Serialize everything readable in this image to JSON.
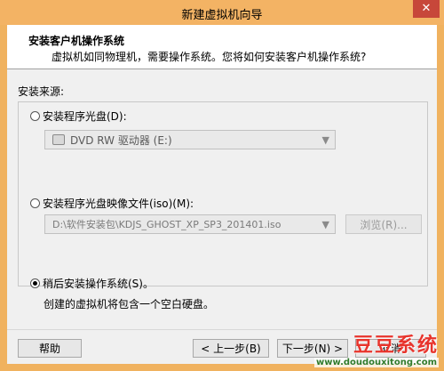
{
  "window": {
    "title": "新建虚拟机向导",
    "close_glyph": "✕"
  },
  "header": {
    "title": "安装客户机操作系统",
    "subtitle": "虚拟机如同物理机，需要操作系统。您将如何安装客户机操作系统?"
  },
  "install_source_label": "安装来源:",
  "options": {
    "disc": {
      "label": "安装程序光盘(D):",
      "selected": false,
      "drive_value": "DVD RW 驱动器 (E:)"
    },
    "iso": {
      "label": "安装程序光盘映像文件(iso)(M):",
      "selected": false,
      "path_value": "D:\\软件安装包\\KDJS_GHOST_XP_SP3_201401.iso",
      "browse_label": "浏览(R)..."
    },
    "later": {
      "label": "稍后安装操作系统(S)。",
      "selected": true,
      "description": "创建的虚拟机将包含一个空白硬盘。"
    }
  },
  "footer": {
    "help_label": "帮助",
    "back_label": "< 上一步(B)",
    "next_label": "下一步(N) >",
    "cancel_label": "取消"
  },
  "watermark": {
    "title": "豆豆系统",
    "url": "www.doudouxitong.com"
  },
  "colors": {
    "titlebar": "#f3b364",
    "close": "#c7473a",
    "watermark_red": "#e8342c",
    "watermark_green": "#2f7a2a"
  }
}
